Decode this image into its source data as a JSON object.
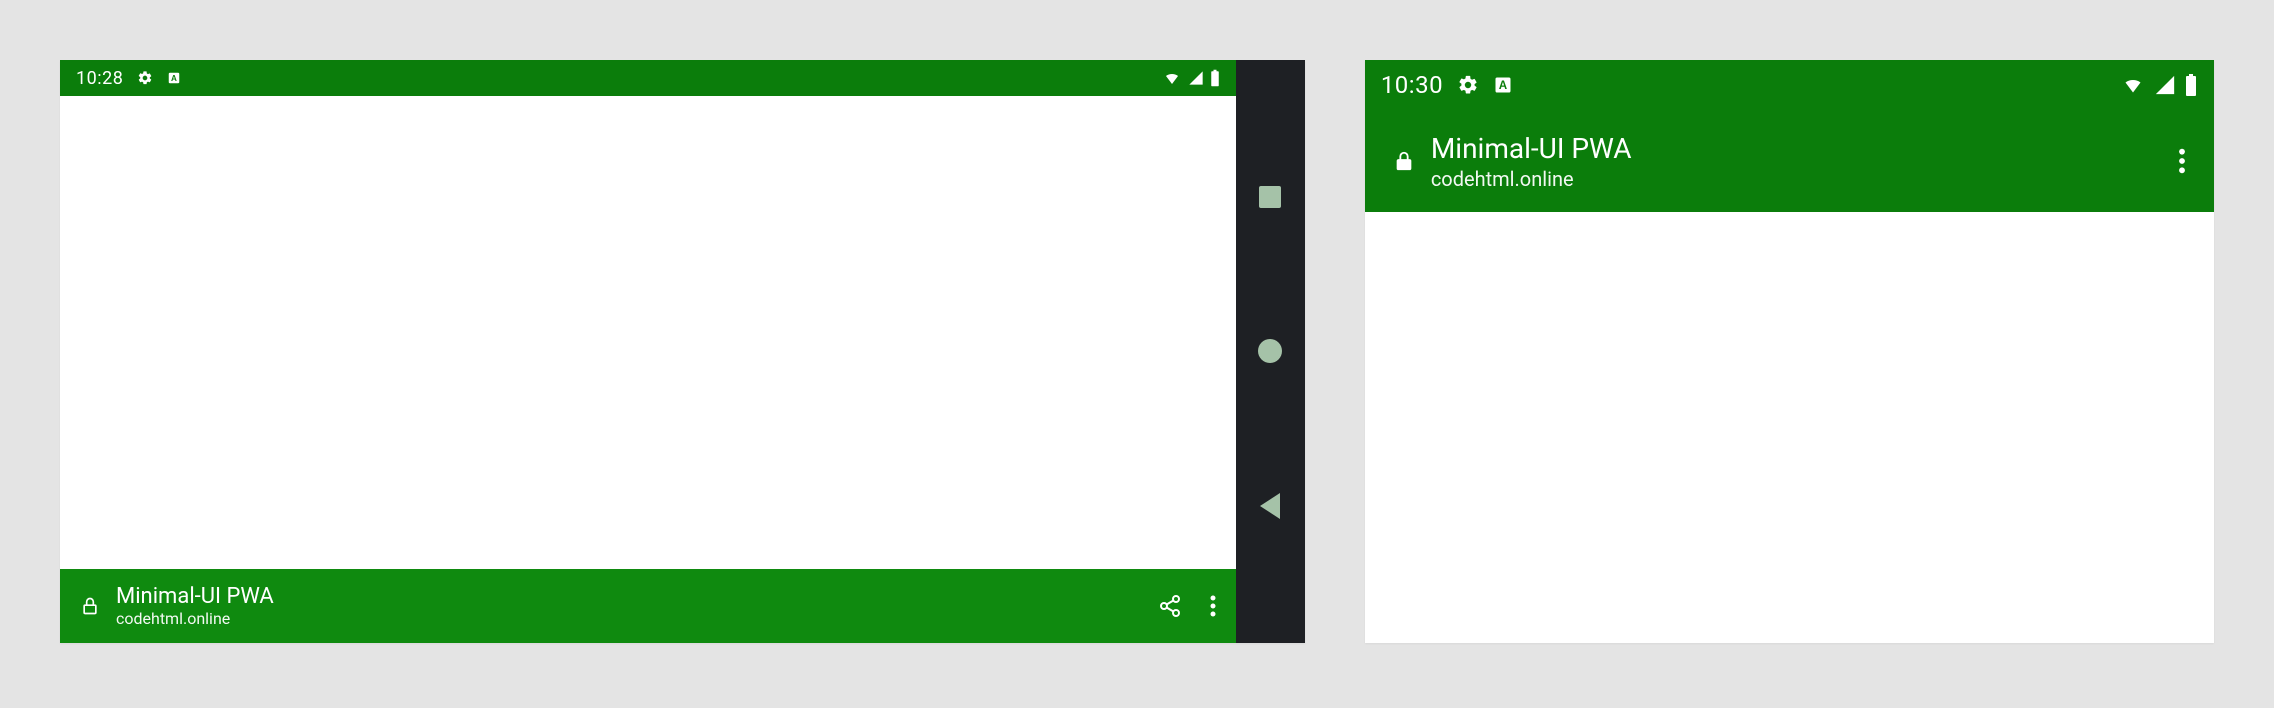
{
  "left": {
    "status": {
      "time": "10:28"
    },
    "app": {
      "title": "Minimal-UI PWA",
      "domain": "codehtml.online"
    }
  },
  "right": {
    "status": {
      "time": "10:30"
    },
    "app": {
      "title": "Minimal-UI PWA",
      "domain": "codehtml.online"
    }
  },
  "colors": {
    "theme": "#0b7d0b",
    "nav": "#1e2024"
  }
}
